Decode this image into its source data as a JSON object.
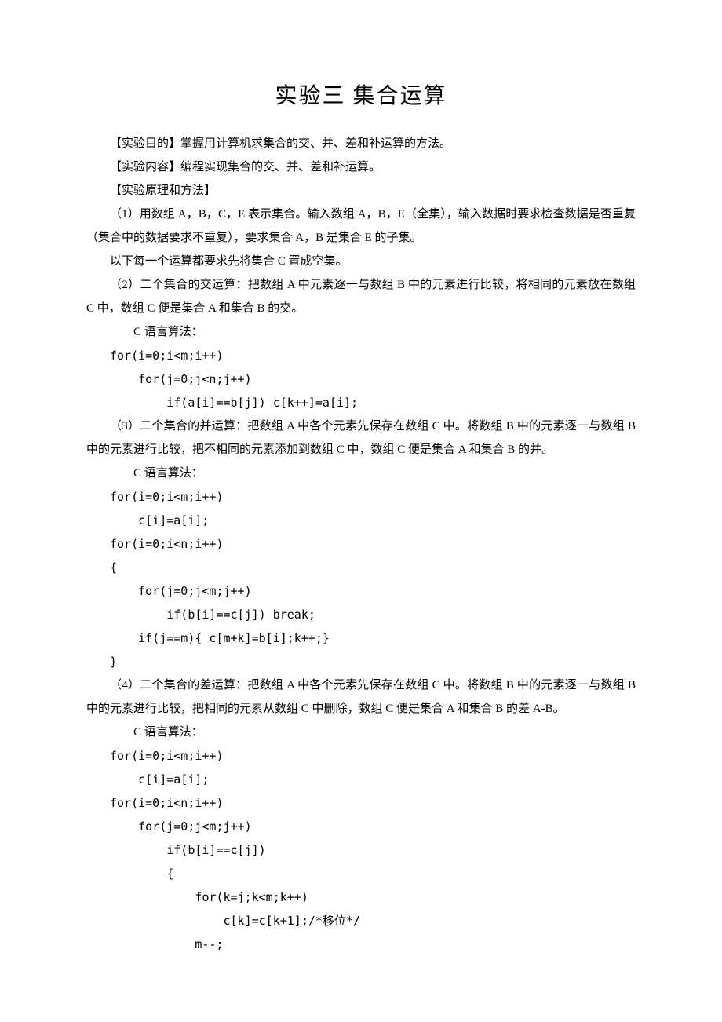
{
  "title": "实验三  集合运算",
  "p1": "【实验目的】掌握用计算机求集合的交、并、差和补运算的方法。",
  "p2": "【实验内容】编程实现集合的交、并、差和补运算。",
  "p3": "【实验原理和方法】",
  "p4": "（1）用数组 A，B，C，E 表示集合。输入数组 A，B，E（全集），输入数据时要求检查数据是否重复（集合中的数据要求不重复），要求集合 A，B 是集合 E 的子集。",
  "p5": "以下每一个运算都要求先将集合 C 置成空集。",
  "p6": "（2）二个集合的交运算：把数组 A 中元素逐一与数组 B 中的元素进行比较，将相同的元素放在数组 C 中，数组 C 便是集合 A 和集合 B 的交。",
  "label1": "C 语言算法：",
  "code1": "for(i=0;i<m;i++)\n    for(j=0;j<n;j++)\n        if(a[i]==b[j]) c[k++]=a[i];",
  "p7": "（3）二个集合的并运算：把数组 A 中各个元素先保存在数组 C 中。将数组 B 中的元素逐一与数组 B 中的元素进行比较，把不相同的元素添加到数组 C 中，数组 C 便是集合 A 和集合 B 的并。",
  "label2": "C 语言算法：",
  "code2": "for(i=0;i<m;i++)\n    c[i]=a[i];\nfor(i=0;i<n;i++)\n{\n    for(j=0;j<m;j++)\n        if(b[i]==c[j]) break;\n    if(j==m){ c[m+k]=b[i];k++;}\n}",
  "p8": "（4）二个集合的差运算：把数组 A 中各个元素先保存在数组 C 中。将数组 B 中的元素逐一与数组 B 中的元素进行比较，把相同的元素从数组 C 中删除，数组 C 便是集合 A 和集合 B 的差 A-B。",
  "label3": "C 语言算法：",
  "code3": "for(i=0;i<m;i++)\n    c[i]=a[i];\nfor(i=0;i<n;i++)\n    for(j=0;j<m;j++)\n        if(b[i]==c[j])\n        {\n            for(k=j;k<m;k++)\n                c[k]=c[k+1];/*移位*/\n            m--;"
}
